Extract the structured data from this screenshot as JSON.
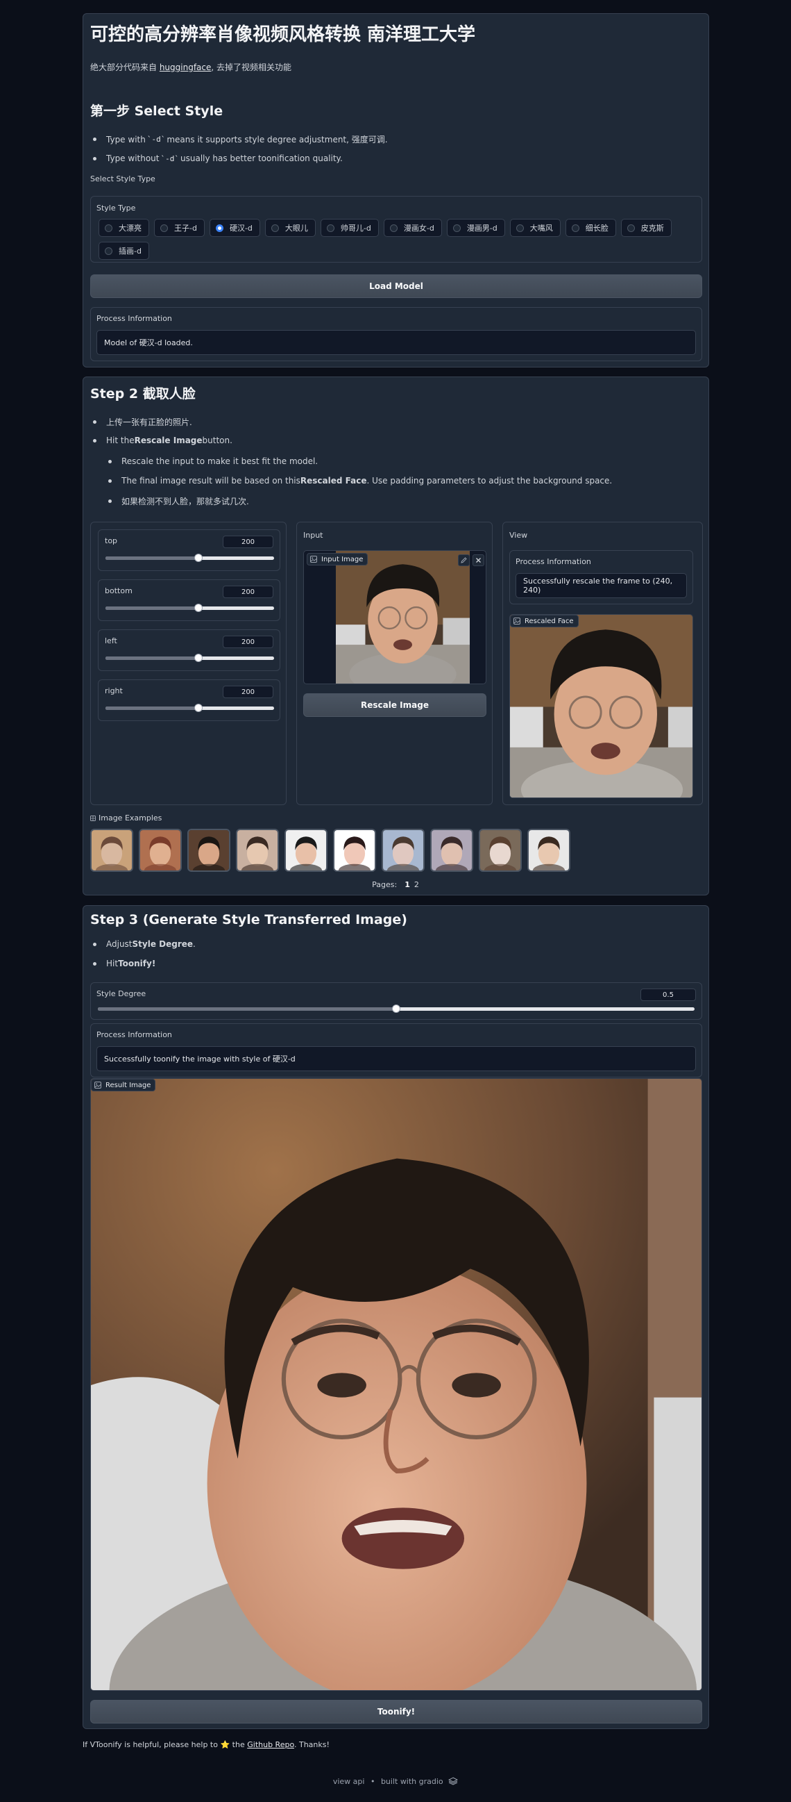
{
  "header": {
    "title": "可控的高分辨率肖像视频风格转换 南洋理工大学",
    "subtitle_prefix": "绝大部分代码来自 ",
    "subtitle_link": "huggingface",
    "subtitle_suffix": ", 去掉了视频相关功能"
  },
  "step1": {
    "heading": "第一步 Select Style",
    "bullets": [
      {
        "pre": "Type with ",
        "code": "`-d`",
        "post": " means it supports style degree adjustment, 强度可调."
      },
      {
        "pre": "Type without ",
        "code": "`-d`",
        "post": " usually has better toonification quality."
      }
    ],
    "select_label": "Select Style Type",
    "style_type_label": "Style Type",
    "options": [
      "大漂亮",
      "王子-d",
      "硬汉-d",
      "大眼儿",
      "帅哥儿-d",
      "漫画女-d",
      "漫画男-d",
      "大嘴风",
      "细长脸",
      "皮克斯",
      "插画-d"
    ],
    "selected": "硬汉-d",
    "load_button": "Load Model",
    "process_label": "Process Information",
    "process_value": "Model of 硬汉-d loaded."
  },
  "step2": {
    "heading": "Step 2 截取人脸",
    "bullets": [
      {
        "pre": "上传一张有正脸的照片.",
        "bold": "",
        "post": ""
      },
      {
        "pre": "Hit the ",
        "bold": "Rescale Image",
        "post": " button."
      }
    ],
    "sub_bullets": [
      {
        "pre": "Rescale the input to make it best fit the model.",
        "bold": "",
        "post": ""
      },
      {
        "pre": "The final image result will be based on this ",
        "bold": "Rescaled Face",
        "post": ". Use padding parameters to adjust the background space."
      },
      {
        "pre": "如果检测不到人脸，那就多试几次.",
        "bold": "",
        "post": ""
      }
    ],
    "sliders": [
      {
        "label": "top",
        "value": "200",
        "fraction": 0.55
      },
      {
        "label": "bottom",
        "value": "200",
        "fraction": 0.55
      },
      {
        "label": "left",
        "value": "200",
        "fraction": 0.55
      },
      {
        "label": "right",
        "value": "200",
        "fraction": 0.55
      }
    ],
    "input_col_label": "Input",
    "input_image_label": "Input Image",
    "rescale_button": "Rescale Image",
    "view_col_label": "View",
    "process_label": "Process Information",
    "process_value": "Successfully rescale the frame to (240, 240)",
    "rescaled_label": "Rescaled Face",
    "examples_label": "Image Examples",
    "pages_label": "Pages:",
    "pages": [
      "1",
      "2"
    ],
    "current_page": "1"
  },
  "step3": {
    "heading": "Step 3 (Generate Style Transferred Image)",
    "bullets": [
      {
        "pre": "Adjust ",
        "bold": "Style Degree",
        "post": "."
      },
      {
        "pre": "Hit ",
        "bold": "Toonify!",
        "post": ""
      }
    ],
    "degree_label": "Style Degree",
    "degree_value": "0.5",
    "degree_fraction": 0.5,
    "process_label": "Process Information",
    "process_value": "Successfully toonify the image with style of 硬汉-d",
    "result_label": "Result Image",
    "toonify_button": "Toonify!"
  },
  "footer": {
    "note_pre": "If VToonify is helpful, please help to ",
    "note_star": "⭐",
    "note_mid": " the ",
    "note_link": "Github Repo",
    "note_post": ". Thanks!",
    "api_link": "view api",
    "separator": "•",
    "built_with": "built with gradio"
  },
  "colors": {
    "accent": "#3b82f6",
    "background": "#0b0f19",
    "panel": "#1f2937"
  }
}
